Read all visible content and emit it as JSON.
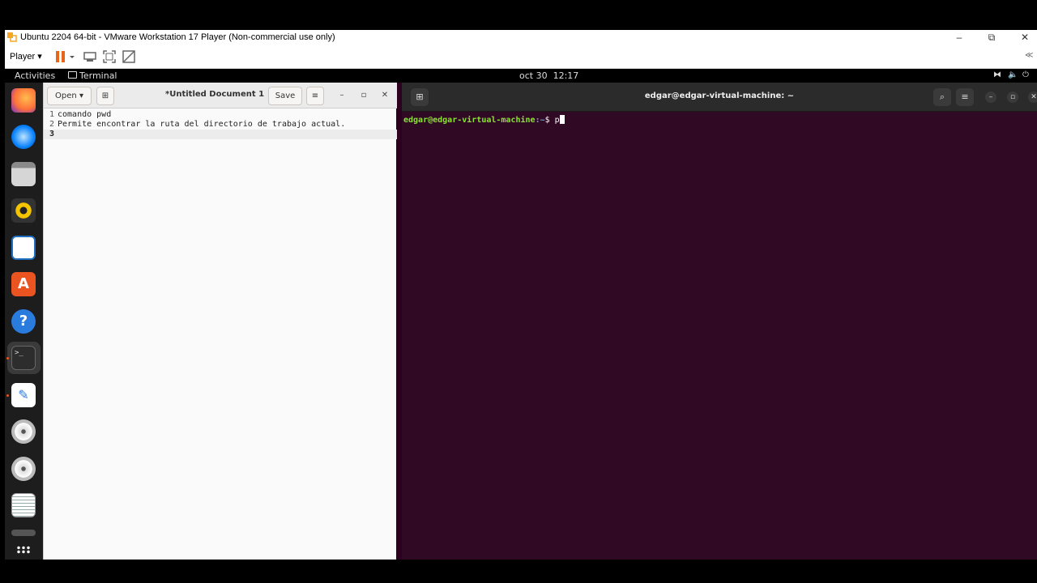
{
  "vmware": {
    "title": "Ubuntu 2204 64-bit - VMware Workstation 17 Player (Non-commercial use only)",
    "player_menu": "Player",
    "window_controls": {
      "minimize": "–",
      "restore": "⧉",
      "close": "✕"
    },
    "colors": {
      "pause": "#e8651c"
    }
  },
  "topbar": {
    "activities": "Activities",
    "app": "Terminal",
    "clock": "oct 30  12:17"
  },
  "dock": {
    "items": [
      "firefox-icon",
      "thunderbird-icon",
      "files-icon",
      "rhythmbox-icon",
      "libreoffice-writer-icon",
      "app-center-icon",
      "help-icon",
      "terminal-icon",
      "text-editor-icon",
      "disc-icon",
      "disc-icon",
      "document-icon",
      "show-apps-icon"
    ]
  },
  "gedit": {
    "open_label": "Open",
    "save_label": "Save",
    "title": "*Untitled Document 1",
    "lines": [
      {
        "num": "1",
        "text": "comando pwd"
      },
      {
        "num": "2",
        "text": "Permite encontrar la ruta del directorio de trabajo actual."
      },
      {
        "num": "3",
        "text": ""
      }
    ]
  },
  "terminal": {
    "title": "edgar@edgar-virtual-machine: ~",
    "prompt_user": "edgar@edgar-virtual-machine",
    "prompt_path": ":~",
    "prompt_symbol": "$ ",
    "input": "p",
    "colors": {
      "prompt": "#8ae234",
      "path": "#729fcf",
      "bg": "#300a24"
    }
  }
}
